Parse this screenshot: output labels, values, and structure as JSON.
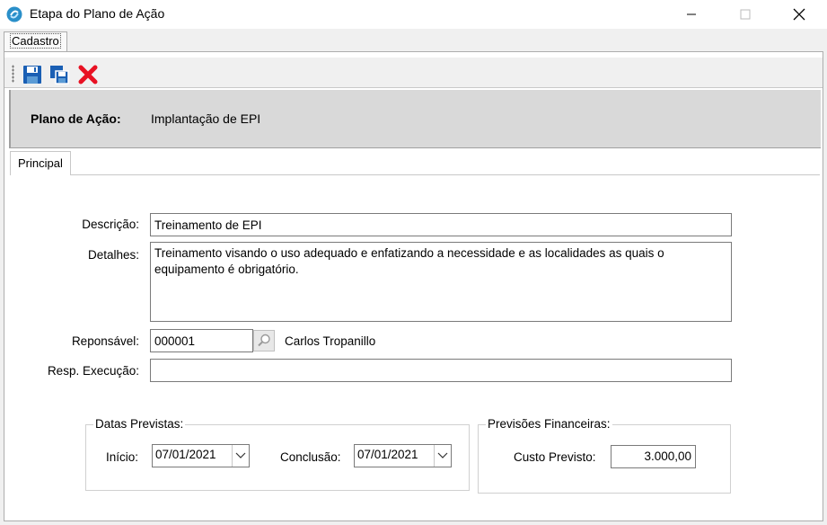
{
  "window": {
    "title": "Etapa do Plano de Ação",
    "icons": {
      "app": "app-logo-icon",
      "minimize": "minimize-icon",
      "maximize": "maximize-icon",
      "close": "close-icon"
    }
  },
  "outer_tab": {
    "label": "Cadastro"
  },
  "toolbar": {
    "items": [
      {
        "name": "save-icon"
      },
      {
        "name": "save-copy-icon"
      },
      {
        "name": "delete-icon",
        "color": "#e81123"
      }
    ],
    "accent_color": "#1a5fb4"
  },
  "header": {
    "label": "Plano de Ação:",
    "value": "Implantação de EPI"
  },
  "inner_tab": {
    "label": "Principal"
  },
  "form": {
    "descricao": {
      "label": "Descrição:",
      "value": "Treinamento de EPI"
    },
    "detalhes": {
      "label": "Detalhes:",
      "value": "Treinamento visando o uso adequado e enfatizando a necessidade e as localidades as quais o equipamento é obrigatório."
    },
    "responsavel": {
      "label": "Reponsável:",
      "code": "000001",
      "name": "Carlos Tropanillo"
    },
    "resp_execucao": {
      "label": "Resp. Execução:",
      "value": ""
    }
  },
  "datas_previstas": {
    "title": "Datas Previstas:",
    "inicio": {
      "label": "Início:",
      "value": "07/01/2021"
    },
    "conclusao": {
      "label": "Conclusão:",
      "value": "07/01/2021"
    }
  },
  "previsoes_financeiras": {
    "title": "Previsões Financeiras:",
    "custo_previsto": {
      "label": "Custo Previsto:",
      "value": "3.000,00"
    }
  }
}
